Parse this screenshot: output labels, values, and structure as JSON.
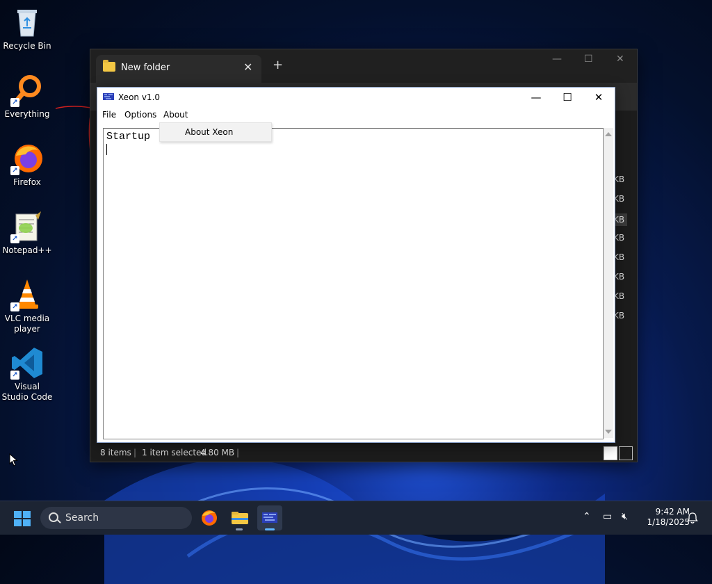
{
  "desktop": {
    "icons": [
      {
        "label": "Recycle Bin",
        "icon": "recycle-bin-icon"
      },
      {
        "label": "Everything",
        "icon": "everything-search-icon"
      },
      {
        "label": "Firefox",
        "icon": "firefox-icon"
      },
      {
        "label": "Notepad++",
        "icon": "notepad-plus-plus-icon"
      },
      {
        "label": "VLC media player",
        "icon": "vlc-cone-icon"
      },
      {
        "label": "Visual Studio Code",
        "icon": "vscode-icon"
      }
    ]
  },
  "explorer": {
    "tab_title": "New folder",
    "file_sizes": [
      "KB",
      "KB",
      "KB",
      "KB",
      "KB",
      "KB",
      "KB",
      "KB"
    ],
    "status": {
      "items": "8 items",
      "selected": "1 item selected",
      "size": "4.80 MB"
    }
  },
  "xeon": {
    "title": "Xeon v1.0",
    "menu": {
      "file": "File",
      "options": "Options",
      "about": "About"
    },
    "about_dropdown": [
      "About Xeon"
    ],
    "editor_text": "Startup"
  },
  "taskbar": {
    "search_label": "Search",
    "pinned": [
      "firefox-icon",
      "file-explorer-icon",
      "xeon-app-icon"
    ],
    "clock": {
      "time": "9:42 AM",
      "date": "1/18/2025"
    }
  },
  "colors": {
    "accent": "#4fb1f7",
    "folder": "#f3c744",
    "active_indicator": "#60b6ff"
  }
}
